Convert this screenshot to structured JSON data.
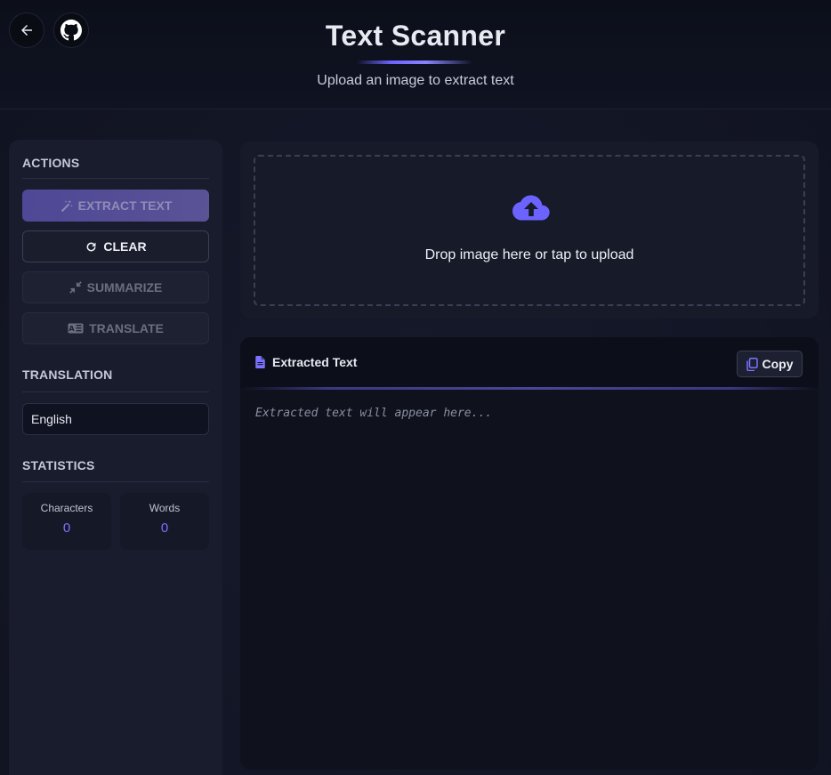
{
  "header": {
    "title": "Text Scanner",
    "subtitle": "Upload an image to extract text",
    "back_icon": "arrow-left-icon",
    "github_icon": "github-icon"
  },
  "sidebar": {
    "actions_title": "ACTIONS",
    "buttons": {
      "extract": "EXTRACT TEXT",
      "clear": "CLEAR",
      "summarize": "SUMMARIZE",
      "translate": "TRANSLATE"
    },
    "translation_title": "TRANSLATION",
    "language_selected": "English",
    "statistics_title": "STATISTICS",
    "stats": {
      "characters_label": "Characters",
      "characters_value": "0",
      "words_label": "Words",
      "words_value": "0"
    }
  },
  "upload": {
    "prompt": "Drop image here or tap to upload",
    "icon": "cloud-upload-icon"
  },
  "output": {
    "title": "Extracted Text",
    "copy_label": "Copy",
    "placeholder": "Extracted text will appear here..."
  },
  "colors": {
    "accent": "#6c63ff",
    "background": "#141826"
  }
}
